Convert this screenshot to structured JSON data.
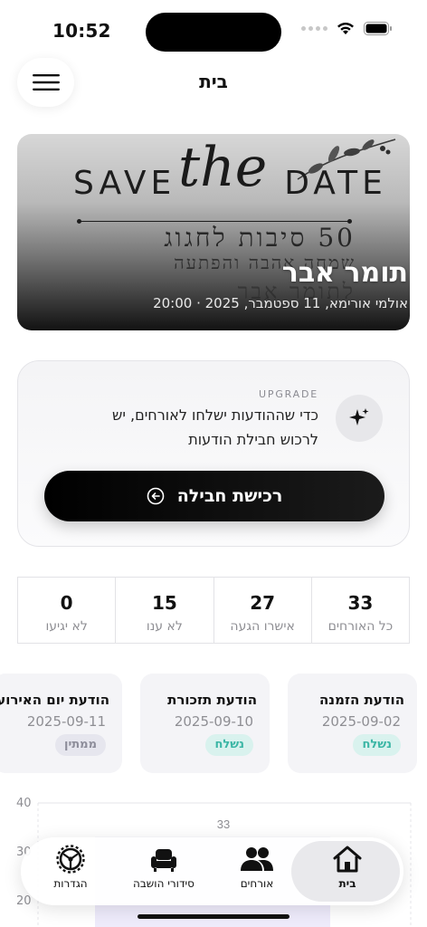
{
  "status_bar": {
    "time": "10:52"
  },
  "header": {
    "title": "בית",
    "menu_icon": "hamburger-icon"
  },
  "event": {
    "card_text": {
      "save": "SAVE",
      "the": "the",
      "date": "DATE",
      "line1": "50 סיבות לחגוג",
      "line2": "שמחה אהבה והפתעה",
      "line3": "לתומר אבר"
    },
    "name": "תומר אבר",
    "details": "אולמי אורימא, 11 ספטמבר, 2025 · 20:00"
  },
  "upgrade": {
    "tag": "UPGRADE",
    "text": "כדי שההודעות ישלחו לאורחים, יש לרכוש חבילת הודעות",
    "button_label": "רכישת חבילה",
    "icon": "sparkles-icon"
  },
  "stats": [
    {
      "value": "33",
      "label": "כל האורחים"
    },
    {
      "value": "27",
      "label": "אישרו הגעה"
    },
    {
      "value": "15",
      "label": "לא ענו"
    },
    {
      "value": "0",
      "label": "לא יגיעו"
    }
  ],
  "messages": [
    {
      "title": "הודעת הזמנה",
      "date": "2025-09-02",
      "status": "נשלח",
      "status_color": "#3bb6a5"
    },
    {
      "title": "הודעת תזכורת",
      "date": "2025-09-10",
      "status": "נשלח",
      "status_color": "#3bb6a5"
    },
    {
      "title": "הודעת יום האירוע",
      "date": "2025-09-11",
      "status": "ממתין",
      "status_color": "#8d8d9a"
    }
  ],
  "chart_data": {
    "type": "bar",
    "y_ticks": [
      "40",
      "30",
      "20"
    ],
    "values": [
      33
    ],
    "value_label": "33"
  },
  "nav": [
    {
      "label": "בית",
      "icon": "home-icon",
      "active": true
    },
    {
      "label": "אורחים",
      "icon": "guests-icon",
      "active": false
    },
    {
      "label": "סידורי הושבה",
      "icon": "seating-icon",
      "active": false
    },
    {
      "label": "הגדרות",
      "icon": "settings-icon",
      "active": false
    }
  ],
  "colors": {
    "accent_sent": "#3bb6a5",
    "chart_bar": "#eeebfb"
  }
}
